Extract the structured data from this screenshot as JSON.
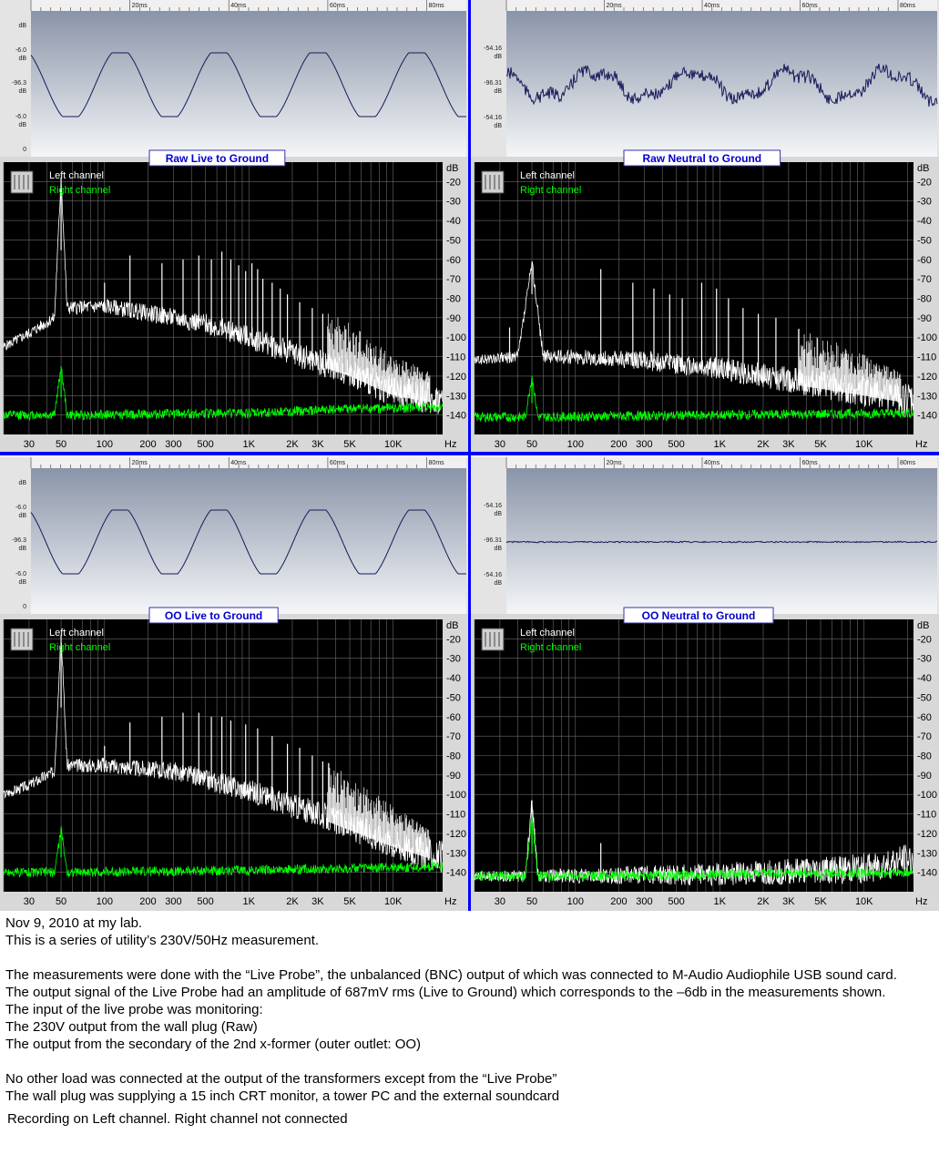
{
  "panels": [
    {
      "title": "Raw Live to Ground",
      "waveform": {
        "time_ticks": [
          "20ms",
          "40ms",
          "60ms",
          "80ms"
        ],
        "amplitude_labels": [
          "dB",
          "-6.0",
          "dB",
          "-96.3",
          "dB",
          "-6.0",
          "dB",
          "0"
        ],
        "shape": "sine",
        "amplitude": 1.0
      },
      "legend": [
        "Left channel",
        "Right channel"
      ],
      "chart_data": {
        "type": "line",
        "title": "Raw Live to Ground",
        "xlabel": "Hz",
        "ylabel": "dB",
        "x_scale": "log",
        "x_ticks": [
          "30",
          "50",
          "100",
          "200",
          "300",
          "500",
          "1K",
          "2K",
          "3K",
          "5K",
          "10K"
        ],
        "y_ticks": [
          "dB",
          "-20",
          "-30",
          "-40",
          "-50",
          "-60",
          "-70",
          "-80",
          "-90",
          "-100",
          "-110",
          "-120",
          "-130",
          "-140"
        ],
        "series": [
          {
            "name": "Left channel",
            "x": [
              20,
              30,
              45,
              50,
              55,
              100,
              150,
              300,
              500,
              1000,
              2000,
              5000,
              10000,
              20000
            ],
            "y": [
              -105,
              -98,
              -90,
              -18,
              -85,
              -84,
              -86,
              -90,
              -93,
              -100,
              -108,
              -118,
              -128,
              -132
            ],
            "spikes": [
              [
                50,
                -18
              ],
              [
                100,
                -72
              ],
              [
                150,
                -58
              ],
              [
                250,
                -62
              ],
              [
                350,
                -60
              ],
              [
                450,
                -58
              ],
              [
                550,
                -60
              ],
              [
                650,
                -56
              ],
              [
                750,
                -60
              ],
              [
                850,
                -63
              ],
              [
                950,
                -66
              ],
              [
                1050,
                -62
              ],
              [
                1150,
                -65
              ],
              [
                1250,
                -70
              ],
              [
                1450,
                -72
              ],
              [
                1650,
                -75
              ],
              [
                1850,
                -78
              ],
              [
                2250,
                -82
              ],
              [
                2750,
                -85
              ],
              [
                3250,
                -88
              ]
            ]
          },
          {
            "name": "Right channel",
            "x": [
              20,
              45,
              50,
              55,
              1000,
              5000,
              20000
            ],
            "y": [
              -140,
              -140,
              -115,
              -140,
              -139,
              -137,
              -136
            ],
            "spikes": [
              [
                50,
                -115
              ]
            ]
          }
        ]
      }
    },
    {
      "title": "Raw Neutral to Ground",
      "waveform": {
        "time_ticks": [
          "20ms",
          "40ms",
          "60ms",
          "80ms"
        ],
        "amplitude_labels": [
          "-54.16",
          "dB",
          "-96.31",
          "dB",
          "-54.16",
          "dB"
        ],
        "shape": "noisy",
        "amplitude": 0.55
      },
      "legend": [
        "Left channel",
        "Right channel"
      ],
      "chart_data": {
        "type": "line",
        "title": "Raw Neutral to Ground",
        "xlabel": "Hz",
        "ylabel": "dB",
        "x_scale": "log",
        "x_ticks": [
          "30",
          "50",
          "100",
          "200",
          "300",
          "500",
          "1K",
          "2K",
          "3K",
          "5K",
          "10K"
        ],
        "y_ticks": [
          "dB",
          "-20",
          "-30",
          "-40",
          "-50",
          "-60",
          "-70",
          "-80",
          "-90",
          "-100",
          "-110",
          "-120",
          "-130",
          "-140"
        ],
        "series": [
          {
            "name": "Left channel",
            "x": [
              20,
              40,
              50,
              60,
              100,
              300,
              1000,
              3000,
              10000,
              20000
            ],
            "y": [
              -112,
              -110,
              -62,
              -110,
              -110,
              -112,
              -116,
              -122,
              -128,
              -132
            ],
            "spikes": [
              [
                35,
                -95
              ],
              [
                50,
                -62
              ],
              [
                150,
                -65
              ],
              [
                250,
                -72
              ],
              [
                350,
                -75
              ],
              [
                450,
                -78
              ],
              [
                550,
                -80
              ],
              [
                750,
                -72
              ],
              [
                950,
                -75
              ],
              [
                1150,
                -80
              ],
              [
                1450,
                -85
              ],
              [
                1850,
                -88
              ],
              [
                2450,
                -90
              ]
            ]
          },
          {
            "name": "Right channel",
            "x": [
              20,
              45,
              50,
              55,
              1000,
              20000
            ],
            "y": [
              -141,
              -141,
              -120,
              -141,
              -140,
              -139
            ],
            "spikes": [
              [
                50,
                -120
              ]
            ]
          }
        ]
      }
    },
    {
      "title": "OO Live to Ground",
      "waveform": {
        "time_ticks": [
          "20ms",
          "40ms",
          "60ms",
          "80ms"
        ],
        "amplitude_labels": [
          "dB",
          "-6.0",
          "dB",
          "-96.3",
          "dB",
          "-6.0",
          "dB",
          "0"
        ],
        "shape": "sine",
        "amplitude": 1.0
      },
      "legend": [
        "Left channel",
        "Right channel"
      ],
      "chart_data": {
        "type": "line",
        "title": "OO Live to Ground",
        "xlabel": "Hz",
        "ylabel": "dB",
        "x_scale": "log",
        "x_ticks": [
          "30",
          "50",
          "100",
          "200",
          "300",
          "500",
          "1K",
          "2K",
          "3K",
          "5K",
          "10K"
        ],
        "y_ticks": [
          "dB",
          "-20",
          "-30",
          "-40",
          "-50",
          "-60",
          "-70",
          "-80",
          "-90",
          "-100",
          "-110",
          "-120",
          "-130",
          "-140"
        ],
        "series": [
          {
            "name": "Left channel",
            "x": [
              20,
              30,
              45,
              50,
              55,
              100,
              300,
              1000,
              3000,
              10000,
              20000
            ],
            "y": [
              -100,
              -95,
              -88,
              -18,
              -85,
              -85,
              -88,
              -98,
              -110,
              -125,
              -132
            ],
            "spikes": [
              [
                50,
                -18
              ],
              [
                100,
                -75
              ],
              [
                150,
                -63
              ],
              [
                250,
                -60
              ],
              [
                350,
                -58
              ],
              [
                450,
                -58
              ],
              [
                550,
                -60
              ],
              [
                650,
                -60
              ],
              [
                750,
                -62
              ],
              [
                950,
                -64
              ],
              [
                1150,
                -66
              ],
              [
                1450,
                -70
              ],
              [
                1850,
                -74
              ],
              [
                2250,
                -76
              ],
              [
                2750,
                -80
              ],
              [
                3250,
                -83
              ]
            ]
          },
          {
            "name": "Right channel",
            "x": [
              20,
              45,
              50,
              55,
              1000,
              20000
            ],
            "y": [
              -140,
              -140,
              -118,
              -140,
              -139,
              -137
            ],
            "spikes": [
              [
                50,
                -118
              ]
            ]
          }
        ]
      }
    },
    {
      "title": "OO Neutral to Ground",
      "waveform": {
        "time_ticks": [
          "20ms",
          "40ms",
          "60ms",
          "80ms"
        ],
        "amplitude_labels": [
          "-54.16",
          "dB",
          "-96.31",
          "dB",
          "-54.16",
          "dB"
        ],
        "shape": "flat",
        "amplitude": 0.0
      },
      "legend": [
        "Left channel",
        "Right channel"
      ],
      "chart_data": {
        "type": "line",
        "title": "OO Neutral to Ground",
        "xlabel": "Hz",
        "ylabel": "dB",
        "x_scale": "log",
        "x_ticks": [
          "30",
          "50",
          "100",
          "200",
          "300",
          "500",
          "1K",
          "2K",
          "3K",
          "5K",
          "10K"
        ],
        "y_ticks": [
          "dB",
          "-20",
          "-30",
          "-40",
          "-50",
          "-60",
          "-70",
          "-80",
          "-90",
          "-100",
          "-110",
          "-120",
          "-130",
          "-140"
        ],
        "series": [
          {
            "name": "Left channel",
            "x": [
              20,
              45,
              50,
              55,
              1000,
              10000,
              20000
            ],
            "y": [
              -142,
              -142,
              -103,
              -142,
              -141,
              -138,
              -134
            ],
            "spikes": [
              [
                50,
                -103
              ],
              [
                150,
                -125
              ]
            ]
          },
          {
            "name": "Right channel",
            "x": [
              20,
              45,
              50,
              55,
              1000,
              20000
            ],
            "y": [
              -142,
              -142,
              -112,
              -142,
              -141,
              -140
            ],
            "spikes": [
              [
                50,
                -112
              ]
            ]
          }
        ]
      }
    }
  ],
  "notes": {
    "lines": [
      "Nov 9, 2010 at my lab.",
      "This is a series of utility’s  230V/50Hz measurement.",
      "",
      "The measurements were done with the “Live Probe”, the unbalanced (BNC) output of which was connected to M-Audio Audiophile USB sound card.",
      "The output signal of the Live Probe had an amplitude of 687mV rms (Live to Ground) which corresponds to the –6db in  the measurements shown.",
      "The input of the live probe was monitoring:",
      "The 230V output from the wall plug (Raw)",
      "The output from the secondary of the 2nd  x-former (outer outlet: OO)",
      "",
      "No other load was connected at the output of the transformers except from the “Live Probe”",
      "The wall plug was supplying a 15 inch CRT monitor, a tower PC and the external soundcard"
    ],
    "footer": "Recording on Left channel. Right channel not connected"
  },
  "colors": {
    "divider": "#0000ff",
    "left_trace": "#ffffff",
    "right_trace": "#00ff00",
    "spectrum_bg": "#000000",
    "frame_bg": "#d8d8d8",
    "waveform_trace": "#1a1a5a",
    "title_text": "#0000cc"
  }
}
